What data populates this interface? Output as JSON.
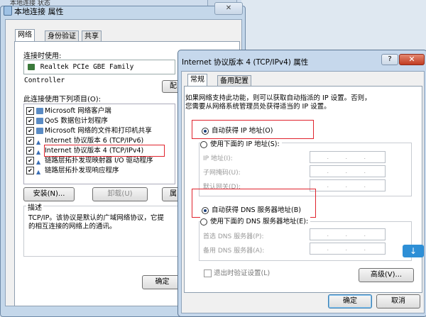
{
  "bg_window": {
    "title": "本地连接 状态"
  },
  "win1": {
    "title": "本地连接 属性",
    "close_symbol": "✕",
    "tabs": [
      "网络",
      "身份验证",
      "共享"
    ],
    "connect_using_label": "连接时使用:",
    "adapter": "Realtek PCIe GBE Family Controller",
    "configure_btn": "配",
    "items_label": "此连接使用下列项目(O):",
    "items": [
      {
        "label": "Microsoft 网络客户端"
      },
      {
        "label": "QoS 数据包计划程序"
      },
      {
        "label": "Microsoft 网络的文件和打印机共享"
      },
      {
        "label": "Internet 协议版本 6 (TCP/IPv6)"
      },
      {
        "label": "Internet 协议版本 4 (TCP/IPv4)"
      },
      {
        "label": "链路层拓扑发现映射器 I/O 驱动程序"
      },
      {
        "label": "链路层拓扑发现响应程序"
      }
    ],
    "install_btn": "安装(N)...",
    "uninstall_btn": "卸载(U)",
    "properties_btn": "属",
    "desc_label": "描述",
    "desc_text_1": "TCP/IP。该协议是默认的广域网络协议，它提",
    "desc_text_2": "的相互连接的网络上的通讯。",
    "ok_btn": "确定"
  },
  "win2": {
    "title": "Internet 协议版本 4 (TCP/IPv4) 属性",
    "help_symbol": "?",
    "close_symbol": "✕",
    "tabs": [
      "常规",
      "备用配置"
    ],
    "info_1": "如果网络支持此功能，则可以获取自动指派的 IP 设置。否则，",
    "info_2": "您需要从网络系统管理员处获得适当的 IP 设置。",
    "auto_ip": "自动获得 IP 地址(O)",
    "manual_ip": "使用下面的 IP 地址(S):",
    "ip_label": "IP 地址(I):",
    "mask_label": "子网掩码(U):",
    "gateway_label": "默认网关(D):",
    "auto_dns": "自动获得 DNS 服务器地址(B)",
    "manual_dns": "使用下面的 DNS 服务器地址(E):",
    "dns1_label": "首选 DNS 服务器(P):",
    "dns2_label": "备用 DNS 服务器(A):",
    "validate_label": "退出时验证设置(L)",
    "advanced_btn": "高级(V)...",
    "ok_btn": "确定",
    "cancel_btn": "取消",
    "dot": "."
  },
  "scroll_symbol": "↓",
  "colors": {
    "highlight_box": "#e0232d",
    "title_bar": "#c6d8ec",
    "close_red": "#c13c22"
  }
}
